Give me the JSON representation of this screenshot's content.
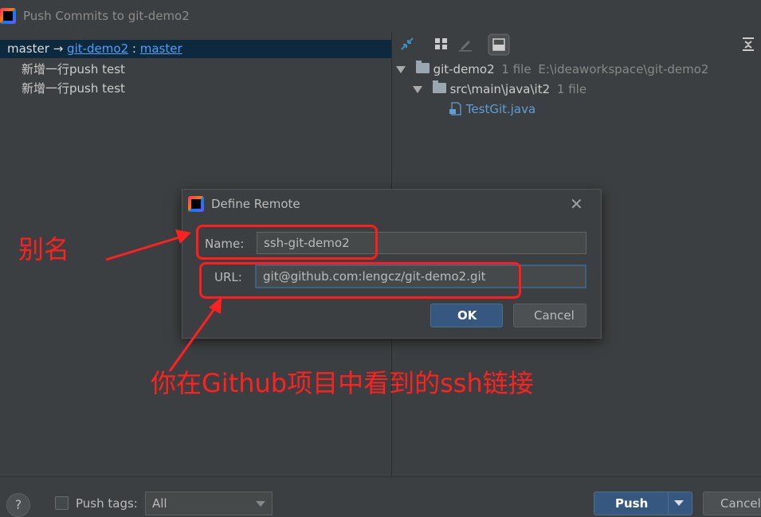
{
  "window": {
    "title": "Push Commits to git-demo2"
  },
  "left": {
    "branch": {
      "local": "master",
      "arrow": "→",
      "remote": "git-demo2",
      "colon": ":",
      "remote_branch": "master"
    },
    "commits": [
      "新增一行push test",
      "新增一行push test"
    ]
  },
  "right": {
    "toolbar": [
      "expand-icon",
      "group-icon",
      "edit-icon",
      "preview-icon",
      "collapse-icon"
    ],
    "tree": {
      "root": {
        "name": "git-demo2",
        "count": "1 file",
        "path": "E:\\ideaworkspace\\git-demo2"
      },
      "folder": {
        "name": "src\\main\\java\\it2",
        "count": "1 file"
      },
      "file": {
        "name": "TestGit.java"
      }
    }
  },
  "bottom": {
    "help": "?",
    "push_tags_label": "Push tags:",
    "push_tags_value": "All",
    "push_label": "Push",
    "cancel_label": "Cancel"
  },
  "dialog": {
    "title": "Define Remote",
    "close": "✕",
    "name_label": "Name:",
    "name_value": "ssh-git-demo2",
    "url_label": "URL:",
    "url_value": "git@github.com:lengcz/git-demo2.git",
    "ok_label": "OK",
    "cancel_label": "Cancel"
  },
  "annotations": {
    "alias": "别名",
    "note": "你在Github项目中看到的ssh链接",
    "color": "#ff2020"
  }
}
